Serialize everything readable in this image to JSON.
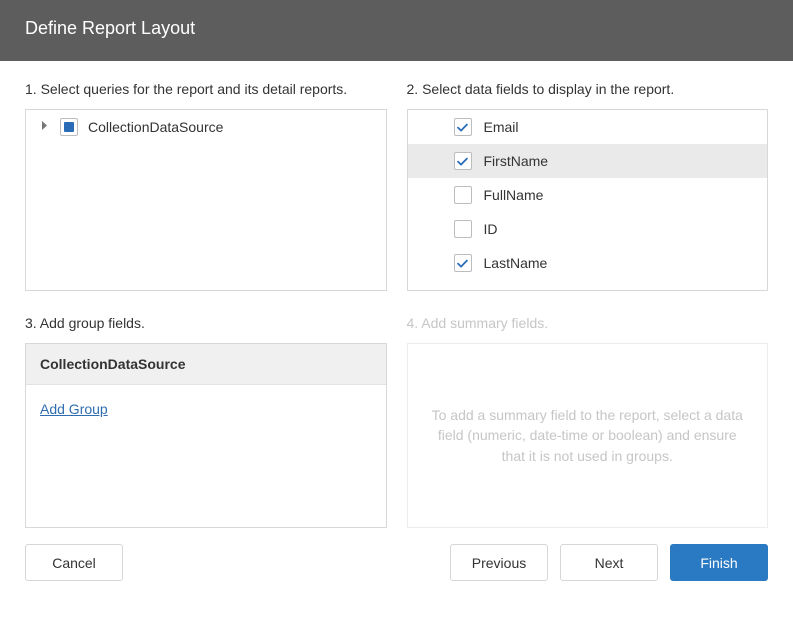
{
  "title": "Define Report Layout",
  "sections": {
    "queries_label": "1. Select queries for the report and its detail reports.",
    "fields_label": "2. Select data fields to display in the report.",
    "groups_label": "3. Add group fields.",
    "summary_label": "4. Add summary fields."
  },
  "queries": [
    {
      "name": "CollectionDataSource",
      "state": "indeterminate"
    }
  ],
  "fields": [
    {
      "name": "Email",
      "checked": true,
      "selected": false
    },
    {
      "name": "FirstName",
      "checked": true,
      "selected": true
    },
    {
      "name": "FullName",
      "checked": false,
      "selected": false
    },
    {
      "name": "ID",
      "checked": false,
      "selected": false
    },
    {
      "name": "LastName",
      "checked": true,
      "selected": false
    }
  ],
  "groups": {
    "header": "CollectionDataSource",
    "add_link": "Add Group"
  },
  "summary_hint": "To add a summary field to the report, select a data field (numeric, date-time or boolean) and ensure that it is not used in groups.",
  "buttons": {
    "cancel": "Cancel",
    "previous": "Previous",
    "next": "Next",
    "finish": "Finish"
  },
  "colors": {
    "accent": "#2a79c3",
    "check": "#2b6cb7"
  }
}
